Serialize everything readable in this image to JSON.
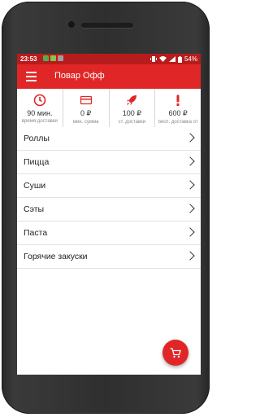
{
  "status_bar": {
    "time": "23:53",
    "battery": "54%",
    "app_icon_colors": [
      "#4caf50",
      "#8bc34a",
      "#9e9e9e"
    ]
  },
  "app_bar": {
    "title": "Повар Офф",
    "menu_icon": "hamburger-menu-icon"
  },
  "info": [
    {
      "icon": "clock-icon",
      "value": "90 мин.",
      "label": "время доставки"
    },
    {
      "icon": "card-icon",
      "value": "0 ₽",
      "label": "мин. сумма"
    },
    {
      "icon": "rocket-icon",
      "value": "100 ₽",
      "label": "ст. доставки"
    },
    {
      "icon": "exclamation-icon",
      "value": "600 ₽",
      "label": "бесп. доставка от"
    }
  ],
  "categories": [
    {
      "label": "Роллы"
    },
    {
      "label": "Пицца"
    },
    {
      "label": "Суши"
    },
    {
      "label": "Сэты"
    },
    {
      "label": "Паста"
    },
    {
      "label": "Горячие закуски"
    }
  ],
  "fab": {
    "icon": "cart-icon"
  },
  "colors": {
    "primary": "#e02626",
    "status_bar": "#b71c1c"
  }
}
